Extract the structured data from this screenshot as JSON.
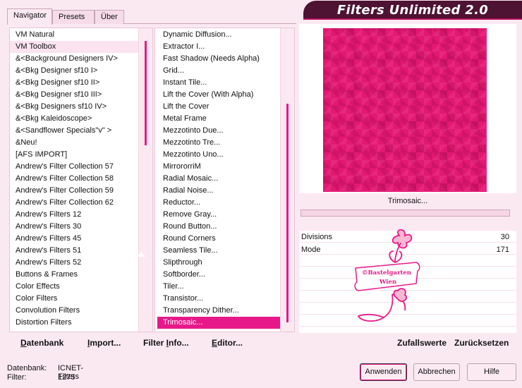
{
  "title": "Filters Unlimited 2.0",
  "tabs": [
    {
      "label": "Navigator",
      "active": true
    },
    {
      "label": "Presets",
      "active": false
    },
    {
      "label": "Über",
      "active": false
    }
  ],
  "categories": [
    "VM Natural",
    "VM Toolbox",
    "&<Background Designers IV>",
    "&<Bkg Designer sf10 I>",
    "&<Bkg Designer sf10 II>",
    "&<Bkg Designer sf10 III>",
    "&<Bkg Designers sf10 IV>",
    "&<Bkg Kaleidoscope>",
    "&<Sandflower Specials\"v\" >",
    "&Neu!",
    "[AFS IMPORT]",
    "Andrew's Filter Collection 57",
    "Andrew's Filter Collection 58",
    "Andrew's Filter Collection 59",
    "Andrew's Filter Collection 62",
    "Andrew's Filters 12",
    "Andrew's Filters 30",
    "Andrew's Filters 45",
    "Andrew's Filters 51",
    "Andrew's Filters 52",
    "Buttons & Frames",
    "Color Effects",
    "Color Filters",
    "Convolution Filters",
    "Distortion Filters"
  ],
  "selected_category": "VM Toolbox",
  "filters": [
    "Dynamic Diffusion...",
    "Extractor I...",
    "Fast Shadow (Needs Alpha)",
    "Grid...",
    "Instant Tile...",
    "Lift the Cover (With Alpha)",
    "Lift the Cover",
    "Metal Frame",
    "Mezzotinto Due...",
    "Mezzotinto Tre...",
    "Mezzotinto Uno...",
    "MirrororriM",
    "Radial Mosaic...",
    "Radial Noise...",
    "Reductor...",
    "Remove Gray...",
    "Round Button...",
    "Round Corners",
    "Seamless Tile...",
    "Slipthrough",
    "Softborder...",
    "Tiler...",
    "Transistor...",
    "Transparency Dither...",
    "Trimosaic..."
  ],
  "selected_filter": "Trimosaic...",
  "preview": {
    "filter_name": "Trimosaic...",
    "progress": 0,
    "base_color": "#e21873"
  },
  "params": [
    {
      "label": "Divisions",
      "value": "30"
    },
    {
      "label": "Mode",
      "value": "171"
    }
  ],
  "watermark_text": [
    "©Bastelgarten",
    "Wien"
  ],
  "link_buttons": {
    "database": {
      "underline": "D",
      "rest": "atenbank"
    },
    "import": {
      "underline": "I",
      "rest": "mport..."
    },
    "filter_info": {
      "pre": "Filter ",
      "underline": "I",
      "rest": "nfo..."
    },
    "editor": {
      "underline": "E",
      "rest": "ditor..."
    },
    "random": "Zufallswerte",
    "reset": "Zurücksetzen"
  },
  "status": {
    "database_label": "Datenbank:",
    "database_value": "ICNET-Filters",
    "filter_label": "Filter:",
    "filter_value": "1275"
  },
  "buttons": {
    "apply": "Anwenden",
    "cancel": "Abbrechen",
    "help": "Hilfe"
  },
  "colors": {
    "accent": "#e7198a",
    "background": "#fbe9f2",
    "title_bar": "#4e1232"
  }
}
